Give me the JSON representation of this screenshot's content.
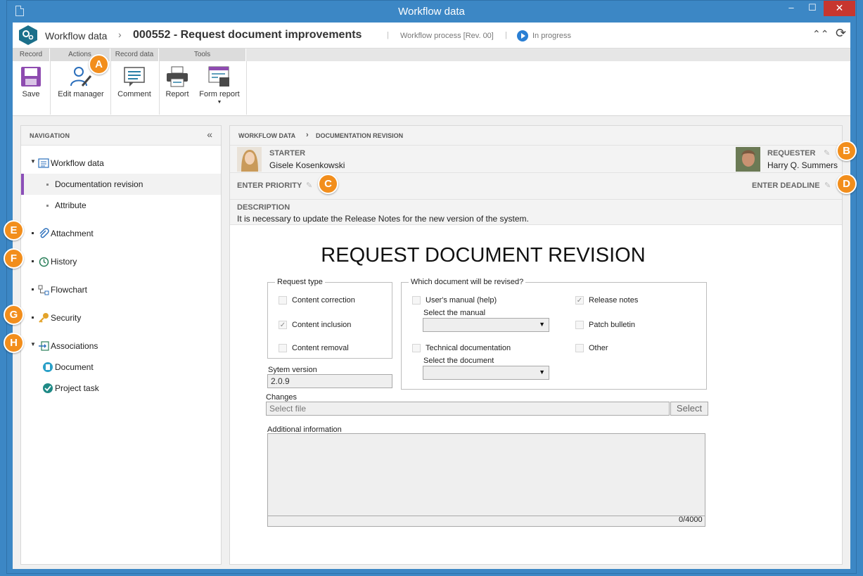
{
  "window": {
    "title": "Workflow data",
    "minimize": "–",
    "maximize": "☐",
    "close": "✕"
  },
  "header": {
    "app_name": "Workflow data",
    "chevron": "›",
    "record_title": "000552 - Request document improvements",
    "separator": "|",
    "process": "Workflow process [Rev. 00]",
    "status": "In progress",
    "collapse_icon": "chevrons-up-icon",
    "refresh_icon": "refresh-icon"
  },
  "ribbon": {
    "groups": [
      "Record",
      "Actions",
      "Record data",
      "Tools"
    ],
    "buttons": {
      "save": "Save",
      "edit_manager": "Edit manager",
      "comment": "Comment",
      "report": "Report",
      "form_report": "Form report"
    }
  },
  "navigation": {
    "title": "NAVIGATION",
    "collapse": "«",
    "items": {
      "workflow_data": "Workflow data",
      "documentation_revision": "Documentation revision",
      "attribute": "Attribute",
      "attachment": "Attachment",
      "history": "History",
      "flowchart": "Flowchart",
      "security": "Security",
      "associations": "Associations",
      "document": "Document",
      "project_task": "Project task"
    }
  },
  "content": {
    "breadcrumb": [
      "WORKFLOW DATA",
      "DOCUMENTATION REVISION"
    ],
    "starter_label": "STARTER",
    "starter_name": "Gisele Kosenkowski",
    "requester_label": "REQUESTER",
    "requester_name": "Harry Q. Summers",
    "priority_label": "ENTER PRIORITY",
    "deadline_label": "ENTER DEADLINE",
    "description_label": "DESCRIPTION",
    "description_text": "It is necessary to update the Release Notes for the new version of the system."
  },
  "form": {
    "title": "REQUEST DOCUMENT REVISION",
    "request_type": {
      "legend": "Request type",
      "options": [
        {
          "label": "Content correction",
          "checked": false
        },
        {
          "label": "Content inclusion",
          "checked": true
        },
        {
          "label": "Content removal",
          "checked": false
        }
      ]
    },
    "which_document": {
      "legend": "Which document will be revised?",
      "users_manual": {
        "label": "User's manual (help)",
        "checked": false
      },
      "select_manual_label": "Select the manual",
      "technical_doc": {
        "label": "Technical documentation",
        "checked": false
      },
      "select_document_label": "Select the document",
      "release_notes": {
        "label": "Release notes",
        "checked": true
      },
      "patch_bulletin": {
        "label": "Patch bulletin",
        "checked": false
      },
      "other": {
        "label": "Other",
        "checked": false
      }
    },
    "system_version_label": "Sytem version",
    "system_version_value": "2.0.9",
    "changes_label": "Changes",
    "changes_placeholder": "Select file",
    "select_button": "Select",
    "additional_info_label": "Additional information",
    "additional_info_counter": "0/4000"
  },
  "callouts": [
    "A",
    "B",
    "C",
    "D",
    "E",
    "F",
    "G",
    "H"
  ],
  "colors": {
    "accent_orange": "#f28e1c",
    "window_blue": "#3c87c5",
    "selection_purple": "#8c4fb8",
    "status_blue": "#2a7fd4"
  }
}
